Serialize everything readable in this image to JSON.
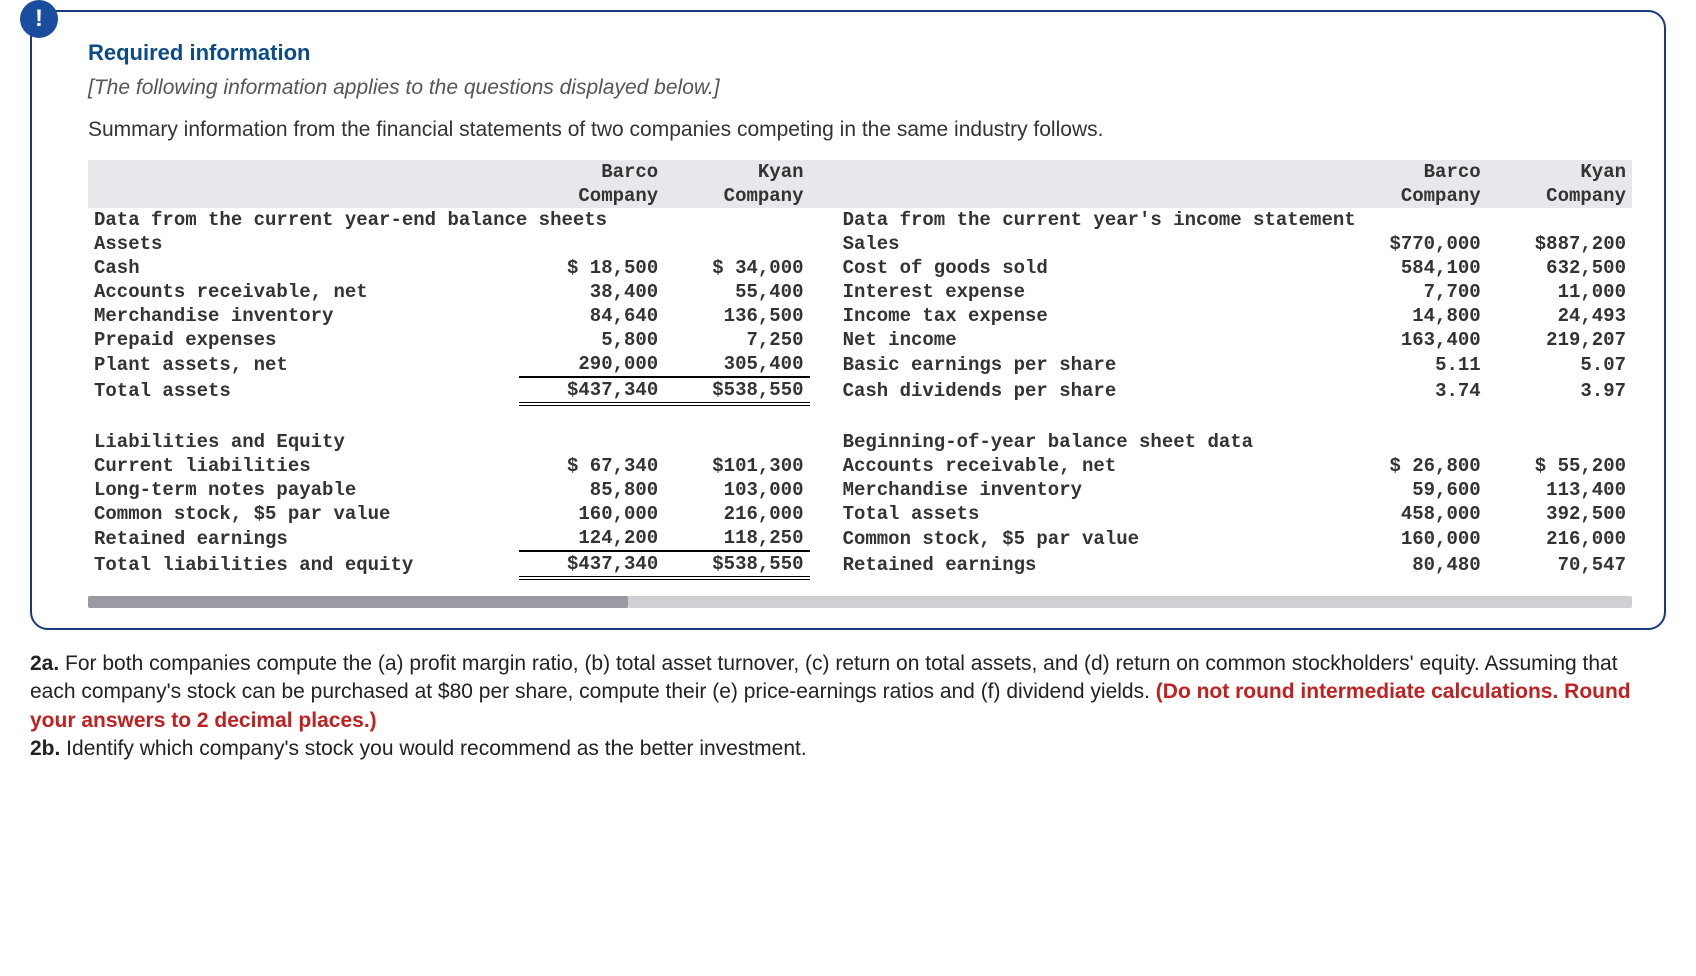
{
  "header": {
    "required": "Required information",
    "italic": "[The following information applies to the questions displayed below.]",
    "summary": "Summary information from the financial statements of two companies competing in the same industry follows."
  },
  "col": {
    "barco1": "Barco",
    "barco2": "Company",
    "kyan1": "Kyan",
    "kyan2": "Company"
  },
  "left": {
    "title": "Data from the current year-end balance sheets",
    "assets": {
      "h": "Assets",
      "cash": {
        "l": "Cash",
        "b": "$ 18,500",
        "k": "$ 34,000"
      },
      "ar": {
        "l": "Accounts receivable, net",
        "b": "38,400",
        "k": "55,400"
      },
      "mi": {
        "l": "Merchandise inventory",
        "b": "84,640",
        "k": "136,500"
      },
      "pe": {
        "l": "Prepaid expenses",
        "b": "5,800",
        "k": "7,250"
      },
      "pa": {
        "l": "Plant assets, net",
        "b": "290,000",
        "k": "305,400"
      },
      "ta": {
        "l": "Total assets",
        "b": "$437,340",
        "k": "$538,550"
      }
    },
    "liab": {
      "h": "Liabilities and Equity",
      "cl": {
        "l": "Current liabilities",
        "b": "$ 67,340",
        "k": "$101,300"
      },
      "lt": {
        "l": "Long-term notes payable",
        "b": "85,800",
        "k": "103,000"
      },
      "cs": {
        "l": "Common stock, $5 par value",
        "b": "160,000",
        "k": "216,000"
      },
      "re": {
        "l": "Retained earnings",
        "b": "124,200",
        "k": "118,250"
      },
      "tle": {
        "l": "Total liabilities and equity",
        "b": "$437,340",
        "k": "$538,550"
      }
    }
  },
  "right": {
    "title": "Data from the current year's income statement",
    "is": {
      "sales": {
        "l": "Sales",
        "b": "$770,000",
        "k": "$887,200"
      },
      "cogs": {
        "l": "Cost of goods sold",
        "b": "584,100",
        "k": "632,500"
      },
      "int": {
        "l": "Interest expense",
        "b": "7,700",
        "k": "11,000"
      },
      "tax": {
        "l": "Income tax expense",
        "b": "14,800",
        "k": "24,493"
      },
      "ni": {
        "l": "Net income",
        "b": "163,400",
        "k": "219,207"
      },
      "eps": {
        "l": "Basic earnings per share",
        "b": "5.11",
        "k": "5.07"
      },
      "div": {
        "l": "Cash dividends per share",
        "b": "3.74",
        "k": "3.97"
      }
    },
    "boy": {
      "h": "Beginning-of-year balance sheet data",
      "ar": {
        "l": "Accounts receivable, net",
        "b": "$ 26,800",
        "k": "$ 55,200"
      },
      "mi": {
        "l": "Merchandise inventory",
        "b": "59,600",
        "k": "113,400"
      },
      "ta": {
        "l": "Total assets",
        "b": "458,000",
        "k": "392,500"
      },
      "cs": {
        "l": "Common stock, $5 par value",
        "b": "160,000",
        "k": "216,000"
      },
      "re": {
        "l": "Retained earnings",
        "b": "80,480",
        "k": "70,547"
      }
    }
  },
  "q": {
    "p2a_b": "2a.",
    "p2a": " For both companies compute the (a) profit margin ratio, (b) total asset turnover, (c) return on total assets, and (d) return on common stockholders' equity. Assuming that each company's stock can be purchased at $80 per share, compute their (e) price-earnings ratios and (f) dividend yields. ",
    "red": "(Do not round intermediate calculations. Round your answers to 2 decimal places.)",
    "p2b_b": "2b.",
    "p2b": " Identify which company's stock you would recommend as the better investment."
  }
}
